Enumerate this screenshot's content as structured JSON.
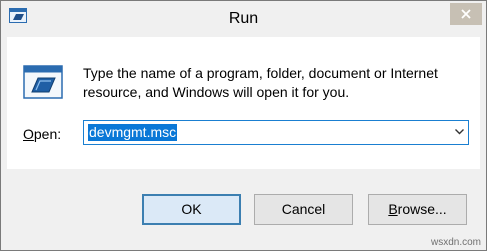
{
  "window": {
    "title": "Run"
  },
  "description": "Type the name of a program, folder, document or Internet resource, and Windows will open it for you.",
  "open_field": {
    "label_accel": "O",
    "label_rest": "pen:",
    "value": "devmgmt.msc"
  },
  "buttons": {
    "ok": "OK",
    "cancel": "Cancel",
    "browse_accel": "B",
    "browse_rest": "rowse..."
  },
  "watermark": "wsxdn.com",
  "icons": {
    "app": "run-app-icon",
    "dialog": "run-icon",
    "close": "close-icon",
    "dropdown": "chevron-down-icon"
  },
  "colors": {
    "accent": "#0a78d7",
    "close_bg": "#c7c0b4",
    "primary_border": "#3c7fb1"
  }
}
